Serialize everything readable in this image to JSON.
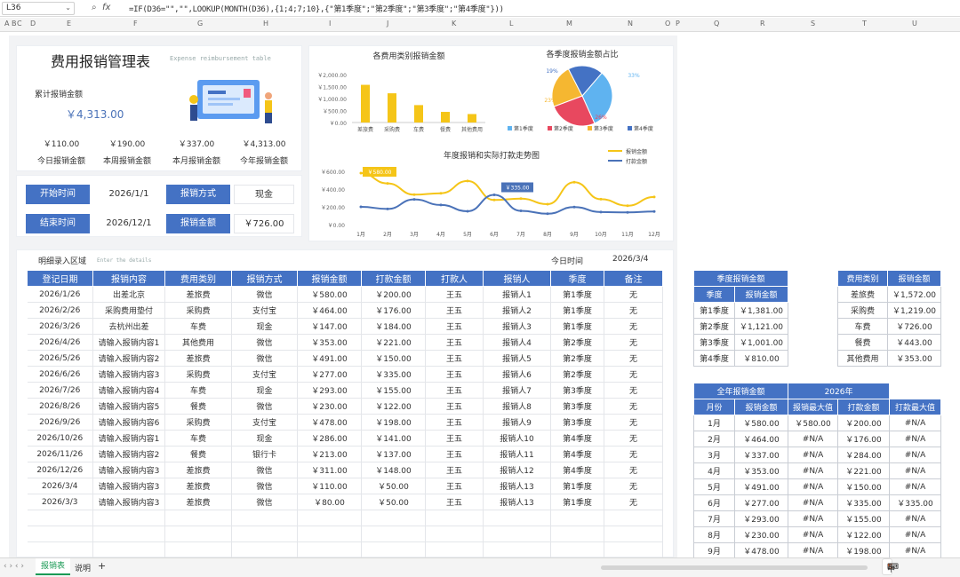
{
  "formula_bar": {
    "cell_ref": "L36",
    "formula": "=IF(D36=\"\",\"\",LOOKUP(MONTH(D36),{1;4;7;10},{\"第1季度\";\"第2季度\";\"第3季度\";\"第4季度\"}))"
  },
  "columns": [
    "A",
    "B",
    "C",
    "D",
    "E",
    "F",
    "G",
    "H",
    "I",
    "J",
    "K",
    "L",
    "M",
    "N",
    "O",
    "P",
    "Q",
    "R",
    "S",
    "T",
    "U"
  ],
  "header": {
    "title": "费用报销管理表",
    "subtitle": "Expense reimbursement table",
    "total_label": "累计报销金额",
    "total_value": "￥4,313.00"
  },
  "stats": [
    {
      "value": "￥110.00",
      "label": "今日报销金额"
    },
    {
      "value": "￥190.00",
      "label": "本周报销金额"
    },
    {
      "value": "￥337.00",
      "label": "本月报销金额"
    },
    {
      "value": "￥4,313.00",
      "label": "今年报销金额"
    }
  ],
  "filters": {
    "start_label": "开始时间",
    "start_value": "2026/1/1",
    "method_label": "报销方式",
    "method_value": "现金",
    "end_label": "结束时间",
    "end_value": "2026/12/1",
    "amount_label": "报销金额",
    "amount_value": "￥726.00"
  },
  "chart_bar": {
    "type": "bar",
    "title": "各费用类别报销金额",
    "categories": [
      "差旅费",
      "采购费",
      "车费",
      "餐费",
      "其他费用"
    ],
    "values": [
      1572,
      1219,
      726,
      443,
      353
    ],
    "ylim": [
      0,
      2000
    ],
    "yticks": [
      "￥2,000.00",
      "￥1,500.00",
      "￥1,000.00",
      "￥500.00",
      "￥0.00"
    ],
    "color": "#f5c518"
  },
  "chart_pie": {
    "type": "pie",
    "title": "各季度报销金额占比",
    "labels": [
      "第1季度",
      "第2季度",
      "第3季度",
      "第4季度"
    ],
    "values": [
      1381,
      1121,
      1001,
      810
    ],
    "percent_labels": [
      "33%",
      "26%",
      "23%",
      "19%"
    ],
    "colors": [
      "#5fb3f0",
      "#e8485f",
      "#f5b731",
      "#4472c4"
    ]
  },
  "chart_line": {
    "type": "line",
    "title": "年度报销和实际打款走势图",
    "x": [
      "1月",
      "2月",
      "3月",
      "4月",
      "5月",
      "6月",
      "7月",
      "8月",
      "9月",
      "10月",
      "11月",
      "12月"
    ],
    "ylim": [
      0,
      600
    ],
    "yticks": [
      "￥600.00",
      "￥400.00",
      "￥200.00",
      "￥0.00"
    ],
    "series": [
      {
        "name": "报销金额",
        "values": [
          580,
          464,
          337,
          353,
          491,
          277,
          293,
          230,
          478,
          286,
          213,
          311
        ],
        "color": "#f5c518"
      },
      {
        "name": "打款金额",
        "values": [
          200,
          176,
          284,
          221,
          150,
          335,
          155,
          122,
          198,
          141,
          137,
          148
        ],
        "color": "#4a72b8"
      }
    ],
    "callouts": [
      "￥580.00",
      "￥335.00"
    ]
  },
  "detail": {
    "section_label": "明细录入区域",
    "section_sub": "Enter the details",
    "today_label": "今日时间",
    "today_value": "2026/3/4",
    "headers": [
      "登记日期",
      "报销内容",
      "费用类别",
      "报销方式",
      "报销金额",
      "打款金额",
      "打款人",
      "报销人",
      "季度",
      "备注"
    ],
    "rows": [
      [
        "2026/1/26",
        "出差北京",
        "差旅费",
        "微信",
        "￥580.00",
        "￥200.00",
        "王五",
        "报销人1",
        "第1季度",
        "无"
      ],
      [
        "2026/2/26",
        "采购费用垫付",
        "采购费",
        "支付宝",
        "￥464.00",
        "￥176.00",
        "王五",
        "报销人2",
        "第1季度",
        "无"
      ],
      [
        "2026/3/26",
        "去杭州出差",
        "车费",
        "现金",
        "￥147.00",
        "￥184.00",
        "王五",
        "报销人3",
        "第1季度",
        "无"
      ],
      [
        "2026/4/26",
        "请输入报销内容1",
        "其他费用",
        "微信",
        "￥353.00",
        "￥221.00",
        "王五",
        "报销人4",
        "第2季度",
        "无"
      ],
      [
        "2026/5/26",
        "请输入报销内容2",
        "差旅费",
        "微信",
        "￥491.00",
        "￥150.00",
        "王五",
        "报销人5",
        "第2季度",
        "无"
      ],
      [
        "2026/6/26",
        "请输入报销内容3",
        "采购费",
        "支付宝",
        "￥277.00",
        "￥335.00",
        "王五",
        "报销人6",
        "第2季度",
        "无"
      ],
      [
        "2026/7/26",
        "请输入报销内容4",
        "车费",
        "现金",
        "￥293.00",
        "￥155.00",
        "王五",
        "报销人7",
        "第3季度",
        "无"
      ],
      [
        "2026/8/26",
        "请输入报销内容5",
        "餐费",
        "微信",
        "￥230.00",
        "￥122.00",
        "王五",
        "报销人8",
        "第3季度",
        "无"
      ],
      [
        "2026/9/26",
        "请输入报销内容6",
        "采购费",
        "支付宝",
        "￥478.00",
        "￥198.00",
        "王五",
        "报销人9",
        "第3季度",
        "无"
      ],
      [
        "2026/10/26",
        "请输入报销内容1",
        "车费",
        "现金",
        "￥286.00",
        "￥141.00",
        "王五",
        "报销人10",
        "第4季度",
        "无"
      ],
      [
        "2026/11/26",
        "请输入报销内容2",
        "餐费",
        "银行卡",
        "￥213.00",
        "￥137.00",
        "王五",
        "报销人11",
        "第4季度",
        "无"
      ],
      [
        "2026/12/26",
        "请输入报销内容3",
        "差旅费",
        "微信",
        "￥311.00",
        "￥148.00",
        "王五",
        "报销人12",
        "第4季度",
        "无"
      ],
      [
        "2026/3/4",
        "请输入报销内容3",
        "差旅费",
        "微信",
        "￥110.00",
        "￥50.00",
        "王五",
        "报销人13",
        "第1季度",
        "无"
      ],
      [
        "2026/3/3",
        "请输入报销内容3",
        "差旅费",
        "微信",
        "￥80.00",
        "￥50.00",
        "王五",
        "报销人13",
        "第1季度",
        "无"
      ],
      [
        "",
        "",
        "",
        "",
        "",
        "",
        "",
        "",
        "",
        ""
      ],
      [
        "",
        "",
        "",
        "",
        "",
        "",
        "",
        "",
        "",
        ""
      ],
      [
        "",
        "",
        "",
        "",
        "",
        "",
        "",
        "",
        "",
        ""
      ]
    ]
  },
  "quarter_table": {
    "title": "季度报销金额",
    "headers": [
      "季度",
      "报销金额"
    ],
    "rows": [
      [
        "第1季度",
        "￥1,381.00"
      ],
      [
        "第2季度",
        "￥1,121.00"
      ],
      [
        "第3季度",
        "￥1,001.00"
      ],
      [
        "第4季度",
        "￥810.00"
      ]
    ]
  },
  "category_table": {
    "headers": [
      "费用类别",
      "报销金额"
    ],
    "rows": [
      [
        "差旅费",
        "￥1,572.00"
      ],
      [
        "采购费",
        "￥1,219.00"
      ],
      [
        "车费",
        "￥726.00"
      ],
      [
        "餐费",
        "￥443.00"
      ],
      [
        "其他费用",
        "￥353.00"
      ]
    ]
  },
  "year_table": {
    "title": "全年报销金额",
    "year": "2026年",
    "headers": [
      "月份",
      "报销金额",
      "报销最大值",
      "打款金额",
      "打款最大值"
    ],
    "rows": [
      [
        "1月",
        "￥580.00",
        "￥580.00",
        "￥200.00",
        "#N/A"
      ],
      [
        "2月",
        "￥464.00",
        "#N/A",
        "￥176.00",
        "#N/A"
      ],
      [
        "3月",
        "￥337.00",
        "#N/A",
        "￥284.00",
        "#N/A"
      ],
      [
        "4月",
        "￥353.00",
        "#N/A",
        "￥221.00",
        "#N/A"
      ],
      [
        "5月",
        "￥491.00",
        "#N/A",
        "￥150.00",
        "#N/A"
      ],
      [
        "6月",
        "￥277.00",
        "#N/A",
        "￥335.00",
        "￥335.00"
      ],
      [
        "7月",
        "￥293.00",
        "#N/A",
        "￥155.00",
        "#N/A"
      ],
      [
        "8月",
        "￥230.00",
        "#N/A",
        "￥122.00",
        "#N/A"
      ],
      [
        "9月",
        "￥478.00",
        "#N/A",
        "￥198.00",
        "#N/A"
      ]
    ]
  },
  "tabs": {
    "active": "报销表",
    "other": "说明",
    "add": "+"
  },
  "tray": {
    "lang": "中"
  }
}
